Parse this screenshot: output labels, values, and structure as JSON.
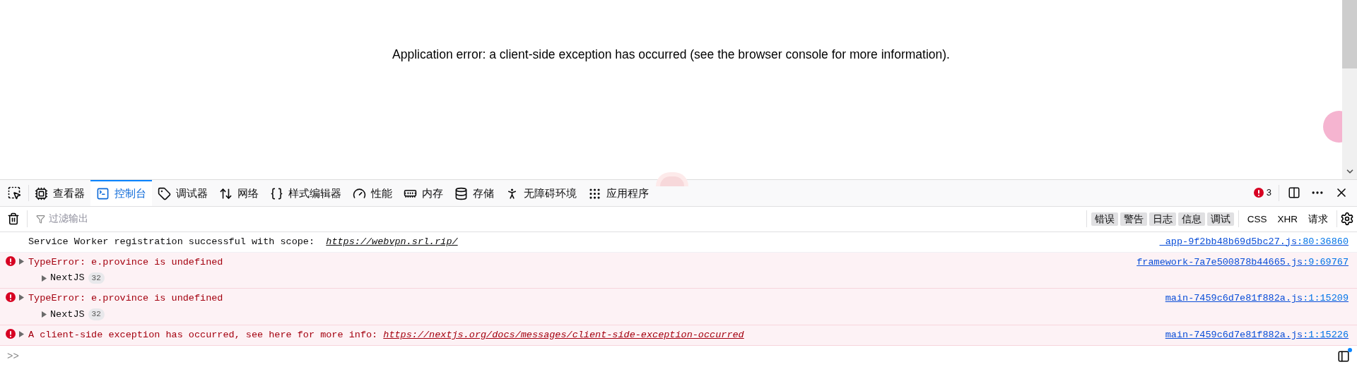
{
  "page": {
    "message": "Application error: a client-side exception has occurred (see the browser console for more information)."
  },
  "devtools": {
    "tabs": [
      {
        "label": "查看器",
        "selected": false
      },
      {
        "label": "控制台",
        "selected": true
      },
      {
        "label": "调试器",
        "selected": false
      },
      {
        "label": "网络",
        "selected": false
      },
      {
        "label": "样式编辑器",
        "selected": false
      },
      {
        "label": "性能",
        "selected": false
      },
      {
        "label": "内存",
        "selected": false
      },
      {
        "label": "存储",
        "selected": false
      },
      {
        "label": "无障碍环境",
        "selected": false
      },
      {
        "label": "应用程序",
        "selected": false
      }
    ],
    "error_count": "3",
    "filter": {
      "placeholder": "过滤输出"
    },
    "levels": [
      {
        "label": "错误",
        "selected": true
      },
      {
        "label": "警告",
        "selected": true
      },
      {
        "label": "日志",
        "selected": true
      },
      {
        "label": "信息",
        "selected": true
      },
      {
        "label": "调试",
        "selected": true
      }
    ],
    "request_filters": [
      {
        "label": "CSS",
        "selected": false
      },
      {
        "label": "XHR",
        "selected": false
      },
      {
        "label": "请求",
        "selected": false
      }
    ],
    "messages": [
      {
        "kind": "log",
        "text": "Service Worker registration successful with scope:  ",
        "link": "https://webvpn.srl.rip/",
        "source": "_app-9f2bb48b69d5bc27.js",
        "location": ":80:36860"
      },
      {
        "kind": "error",
        "expanded": false,
        "text": "TypeError: e.province is undefined",
        "stack": {
          "label": "NextJS",
          "count": "32",
          "expanded": false
        },
        "source": "framework-7a7e500878b44665.js",
        "location": ":9:69767"
      },
      {
        "kind": "error",
        "expanded": false,
        "text": "TypeError: e.province is undefined",
        "stack": {
          "label": "NextJS",
          "count": "32",
          "expanded": false
        },
        "source": "main-7459c6d7e81f882a.js",
        "location": ":1:15209"
      },
      {
        "kind": "error",
        "expanded": false,
        "text": "A client-side exception has occurred, see here for more info: ",
        "link": "https://nextjs.org/docs/messages/client-side-exception-occurred",
        "source": "main-7459c6d7e81f882a.js",
        "location": ":1:15226"
      }
    ],
    "prompt": ">>"
  }
}
